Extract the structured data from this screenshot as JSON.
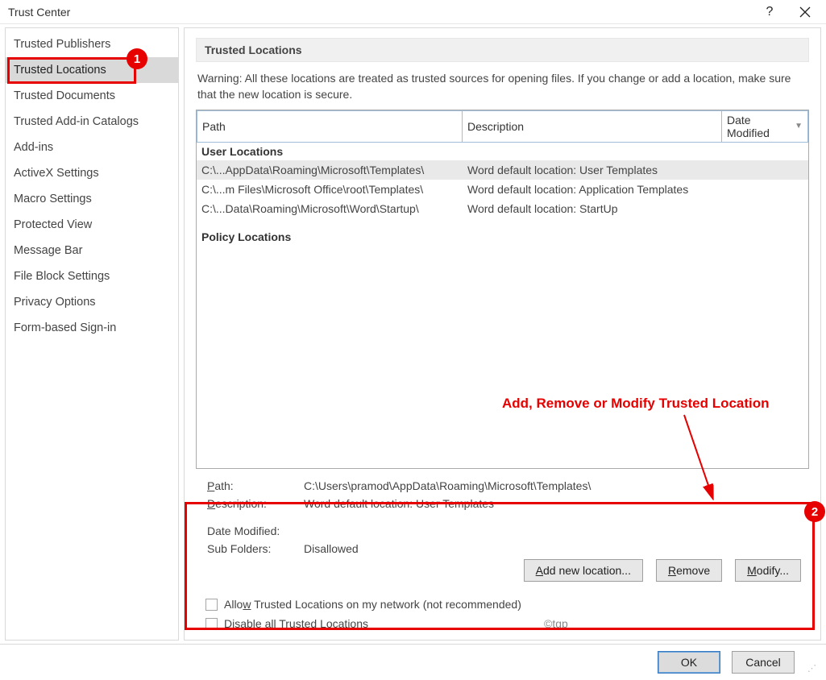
{
  "window": {
    "title": "Trust Center"
  },
  "sidebar": {
    "items": [
      {
        "label": "Trusted Publishers"
      },
      {
        "label": "Trusted Locations"
      },
      {
        "label": "Trusted Documents"
      },
      {
        "label": "Trusted Add-in Catalogs"
      },
      {
        "label": "Add-ins"
      },
      {
        "label": "ActiveX Settings"
      },
      {
        "label": "Macro Settings"
      },
      {
        "label": "Protected View"
      },
      {
        "label": "Message Bar"
      },
      {
        "label": "File Block Settings"
      },
      {
        "label": "Privacy Options"
      },
      {
        "label": "Form-based Sign-in"
      }
    ],
    "selected": "Trusted Locations"
  },
  "section": {
    "title": "Trusted Locations",
    "warning": "Warning: All these locations are treated as trusted sources for opening files.  If you change or add a location, make sure that the new location is secure."
  },
  "table": {
    "headers": {
      "path": "Path",
      "description": "Description",
      "date": "Date Modified"
    },
    "groups": [
      {
        "name": "User Locations",
        "rows": [
          {
            "path": "C:\\...AppData\\Roaming\\Microsoft\\Templates\\",
            "description": "Word default location: User Templates",
            "selected": true
          },
          {
            "path": "C:\\...m Files\\Microsoft Office\\root\\Templates\\",
            "description": "Word default location: Application Templates"
          },
          {
            "path": "C:\\...Data\\Roaming\\Microsoft\\Word\\Startup\\",
            "description": "Word default location: StartUp"
          }
        ]
      },
      {
        "name": "Policy Locations",
        "rows": []
      }
    ]
  },
  "details": {
    "path_label": "Path:",
    "path_value": "C:\\Users\\pramod\\AppData\\Roaming\\Microsoft\\Templates\\",
    "desc_label": "Description:",
    "desc_value": "Word default location: User Templates",
    "date_label": "Date Modified:",
    "date_value": "",
    "sub_label": "Sub Folders:",
    "sub_value": "Disallowed"
  },
  "buttons": {
    "add": "Add new location...",
    "remove": "Remove",
    "modify": "Modify..."
  },
  "checkboxes": {
    "allow": "Allow Trusted Locations on my network (not recommended)",
    "disable": "Disable all Trusted Locations"
  },
  "footer": {
    "ok": "OK",
    "cancel": "Cancel"
  },
  "annotations": {
    "text": "Add, Remove or Modify Trusted Location",
    "badge1": "1",
    "badge2": "2"
  },
  "watermark": "©tgp"
}
